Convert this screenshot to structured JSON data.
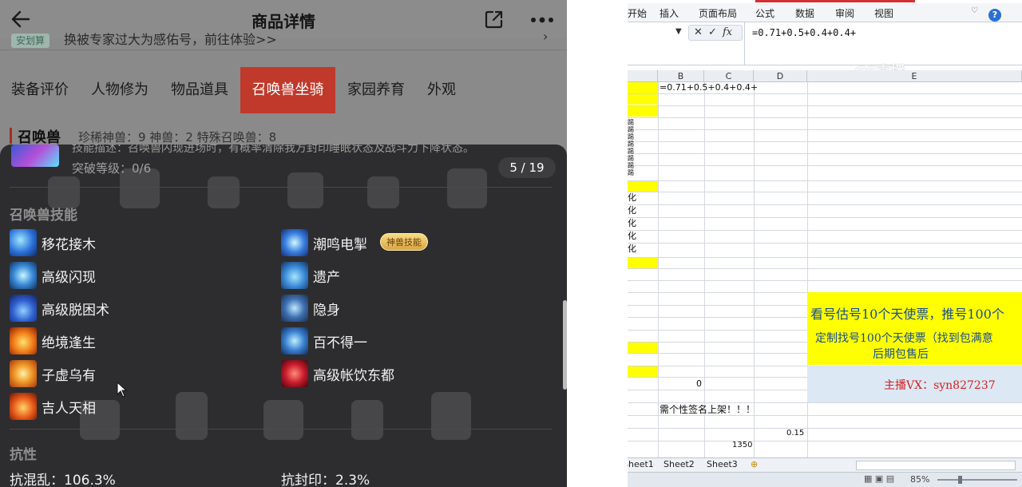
{
  "phone": {
    "title": "商品详情",
    "notice_badge": "安划算",
    "notice_text": "换被专家过大为感佑号，前往体验>>",
    "tabs": [
      "装备评价",
      "人物修为",
      "物品道具",
      "召唤兽坐骑",
      "家园养育",
      "外观"
    ],
    "active_tab": "召唤兽坐骑",
    "section_title": "召唤兽",
    "section_stats": "珍稀神兽：9  神兽：2  特殊召唤兽：8",
    "card": {
      "skill_desc": "技能描述：召唤兽闪现进场时，有概率清除我方封印睡眠状态及战斗力下降状态。",
      "breakthrough": "突破等级：0/6",
      "pager": "5 / 19",
      "skills_heading": "召唤兽技能",
      "skills_left": [
        "移花接木",
        "高级闪现",
        "高级脱困术",
        "绝境逢生",
        "子虚乌有",
        "吉人天相"
      ],
      "skills_right": [
        "潮鸣电掣",
        "遗产",
        "隐身",
        "百不得一",
        "高级帐饮东都"
      ],
      "special_tag": "神兽技能",
      "resist_heading": "抗性",
      "resist": [
        "抗混乱：106.3%",
        "抗封印：2.3%"
      ]
    }
  },
  "excel": {
    "menu": [
      "开始",
      "插入",
      "页面布局",
      "公式",
      "数据",
      "审阅",
      "视图"
    ],
    "help": "?",
    "formula": "=0.71+0.5+0.4+0.4+",
    "fx_x": "✕",
    "fx_check": "✓",
    "fx_fx": "fx",
    "columns": [
      "B",
      "C",
      "D",
      "E"
    ],
    "cell_b_formula": "=0.71+0.5+0.4+0.4+",
    "left_glyph": "化",
    "cell_zero": "0",
    "banner_text": "需个性签名上架！！！",
    "cell_015": "0.15",
    "cell_1350": "1350",
    "promo_1": "看号估号10个天使票，推号100个",
    "promo_2a": "定制找号100个天使票（找到包满意",
    "promo_2b": "后期包售后",
    "promo_3": "主播VX：syn827237",
    "sheets": [
      "Sheet1",
      "Sheet2",
      "Sheet3"
    ],
    "zoom": "85%",
    "watermark": "CC直播"
  }
}
